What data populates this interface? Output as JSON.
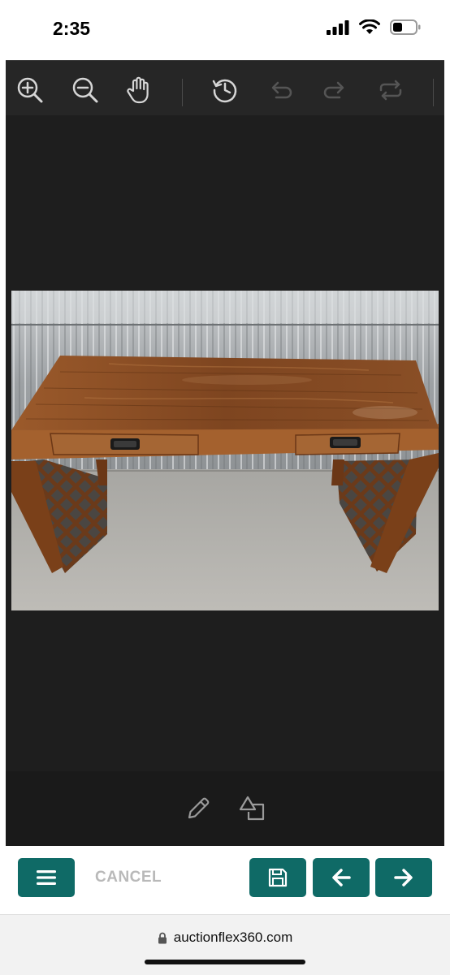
{
  "status_bar": {
    "time": "2:35",
    "battery_level": 0.35
  },
  "toolbar": {
    "icons": [
      "zoom-in-icon",
      "zoom-out-icon",
      "pan-hand-icon",
      "history-icon",
      "undo-icon",
      "redo-icon",
      "repeat-icon"
    ]
  },
  "editor_tools": {
    "icons": [
      "pencil-icon",
      "shapes-icon"
    ]
  },
  "action_bar": {
    "cancel_label": "CANCEL",
    "menu_icon": "menu-icon",
    "save_icon": "save-icon",
    "prev_icon": "arrow-left-icon",
    "next_icon": "arrow-right-icon",
    "accent_color": "#0f6a66"
  },
  "browser": {
    "url": "auctionflex360.com"
  }
}
